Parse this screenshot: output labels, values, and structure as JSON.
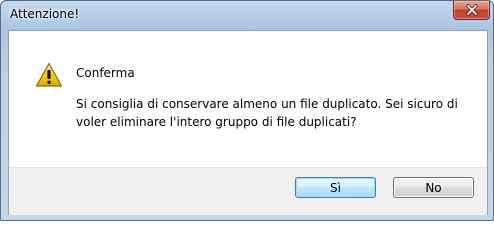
{
  "window": {
    "title": "Attenzione!"
  },
  "dialog": {
    "icon": "warning-icon",
    "header": "Conferma",
    "message_line1": "Si consiglia di conservare almeno un file duplicato. Sei sicuro di",
    "message_line2": "voler eliminare l'intero gruppo di file duplicati?"
  },
  "buttons": {
    "yes_label": "Sì",
    "no_label": "No"
  },
  "colors": {
    "warning_fill": "#f5c518",
    "close_button": "#c8503a",
    "default_button_border": "#3c7fb1"
  }
}
